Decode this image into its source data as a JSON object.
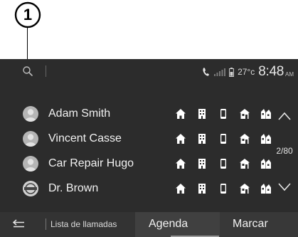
{
  "callout": {
    "number": "1"
  },
  "status": {
    "temperature": "27°c",
    "time": "8:48",
    "ampm": "AM",
    "icons": [
      "phone-icon",
      "signal-icon",
      "battery-icon"
    ]
  },
  "contacts": [
    {
      "name": "Adam Smith",
      "avatar": "person-avatar"
    },
    {
      "name": "Vincent Casse",
      "avatar": "person-avatar"
    },
    {
      "name": "Car Repair Hugo",
      "avatar": "person-avatar"
    },
    {
      "name": "Dr. Brown",
      "avatar": "nissan-logo-avatar"
    }
  ],
  "number_type_icons": [
    "home-icon",
    "office-building-icon",
    "mobile-phone-icon",
    "fax-icon",
    "other-icon"
  ],
  "scroll": {
    "page_indicator": "2/80"
  },
  "tabs": {
    "back_icon": "back-arrow-icon",
    "call_list": "Lista de llamadas",
    "agenda": "Agenda",
    "dial": "Marcar",
    "active": "agenda"
  },
  "colors": {
    "screen_bg": "#2c2c2c",
    "text": "#f2f2f2",
    "active_tab_bg": "#404040"
  }
}
